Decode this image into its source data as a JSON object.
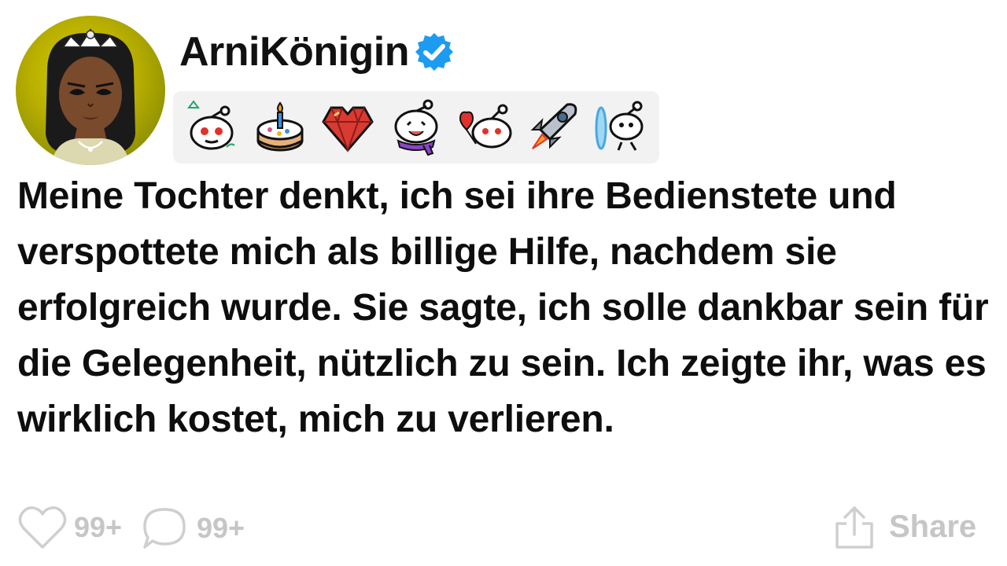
{
  "profile": {
    "username": "ArniKönigin",
    "verified_icon": "verified-badge-icon",
    "avatar_icon": "princess-avatar",
    "badge_icons": [
      "snoo-alien-award-icon",
      "cake-day-award-icon",
      "heart-gem-award-icon",
      "snoo-scarf-award-icon",
      "snoo-heart-balloon-award-icon",
      "rocket-award-icon",
      "portal-snoo-award-icon"
    ]
  },
  "post": {
    "text": "Meine Tochter denkt, ich sei ihre Bedienstete und verspottete mich als billige Hilfe, nachdem sie erfolgreich wurde. Sie sagte, ich solle dankbar sein für die Gelegenheit, nützlich zu sein. Ich zeigte ihr, was es wirklich kostet, mich zu verlieren."
  },
  "actions": {
    "like_count": "99+",
    "comment_count": "99+",
    "share_label": "Share"
  },
  "colors": {
    "verified": "#1d9bf0",
    "footer_gray": "#c6c6c6",
    "badge_bg": "#f2f2f2"
  }
}
